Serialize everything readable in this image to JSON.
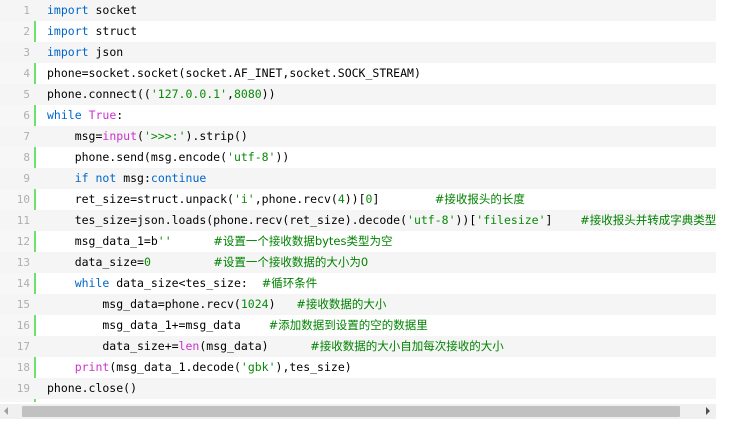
{
  "lines": [
    {
      "n": "1",
      "tokens": [
        {
          "t": "import",
          "c": "k"
        },
        {
          "t": " socket"
        }
      ]
    },
    {
      "n": "2",
      "tokens": [
        {
          "t": "import",
          "c": "k"
        },
        {
          "t": " struct"
        }
      ]
    },
    {
      "n": "3",
      "tokens": [
        {
          "t": "import",
          "c": "k"
        },
        {
          "t": " json"
        }
      ]
    },
    {
      "n": "4",
      "tokens": [
        {
          "t": "phone=socket.socket(socket.AF_INET,socket.SOCK_STREAM)"
        }
      ]
    },
    {
      "n": "5",
      "tokens": [
        {
          "t": "phone.connect(("
        },
        {
          "t": "'127.0.0.1'",
          "c": "s"
        },
        {
          "t": ","
        },
        {
          "t": "8080",
          "c": "n"
        },
        {
          "t": "))"
        }
      ]
    },
    {
      "n": "6",
      "tokens": [
        {
          "t": "while",
          "c": "k"
        },
        {
          "t": " "
        },
        {
          "t": "True",
          "c": "f"
        },
        {
          "t": ":"
        }
      ]
    },
    {
      "n": "7",
      "tokens": [
        {
          "t": "    msg="
        },
        {
          "t": "input",
          "c": "f"
        },
        {
          "t": "("
        },
        {
          "t": "'>>>:'",
          "c": "s"
        },
        {
          "t": ").strip()"
        }
      ]
    },
    {
      "n": "8",
      "tokens": [
        {
          "t": "    phone.send(msg.encode("
        },
        {
          "t": "'utf-8'",
          "c": "s"
        },
        {
          "t": "))"
        }
      ]
    },
    {
      "n": "9",
      "tokens": [
        {
          "t": "    "
        },
        {
          "t": "if",
          "c": "k"
        },
        {
          "t": " "
        },
        {
          "t": "not",
          "c": "k"
        },
        {
          "t": " msg:"
        },
        {
          "t": "continue",
          "c": "k"
        }
      ]
    },
    {
      "n": "10",
      "tokens": [
        {
          "t": "    ret_size=struct.unpack("
        },
        {
          "t": "'i'",
          "c": "s"
        },
        {
          "t": ",phone.recv("
        },
        {
          "t": "4",
          "c": "n"
        },
        {
          "t": "))["
        },
        {
          "t": "0",
          "c": "n"
        },
        {
          "t": "]        "
        },
        {
          "t": "#接收报头的长度",
          "c": "c"
        }
      ]
    },
    {
      "n": "11",
      "tokens": [
        {
          "t": "    tes_size=json.loads(phone.recv(ret_size).decode("
        },
        {
          "t": "'utf-8'",
          "c": "s"
        },
        {
          "t": "))["
        },
        {
          "t": "'filesize'",
          "c": "s"
        },
        {
          "t": "]    "
        },
        {
          "t": "#接收报头并转成字典类型",
          "c": "c"
        }
      ]
    },
    {
      "n": "12",
      "tokens": [
        {
          "t": "    msg_data_1=b"
        },
        {
          "t": "''",
          "c": "s"
        },
        {
          "t": "      "
        },
        {
          "t": "#设置一个接收数据bytes类型为空",
          "c": "c"
        }
      ]
    },
    {
      "n": "13",
      "tokens": [
        {
          "t": "    data_size="
        },
        {
          "t": "0",
          "c": "n"
        },
        {
          "t": "         "
        },
        {
          "t": "#设置一个接收数据的大小为0",
          "c": "c"
        }
      ]
    },
    {
      "n": "14",
      "tokens": [
        {
          "t": "    "
        },
        {
          "t": "while",
          "c": "k"
        },
        {
          "t": " data_size<tes_size:  "
        },
        {
          "t": "#循环条件",
          "c": "c"
        }
      ]
    },
    {
      "n": "15",
      "tokens": [
        {
          "t": "        msg_data=phone.recv("
        },
        {
          "t": "1024",
          "c": "n"
        },
        {
          "t": ")   "
        },
        {
          "t": "#接收数据的大小",
          "c": "c"
        }
      ]
    },
    {
      "n": "16",
      "tokens": [
        {
          "t": "        msg_data_1+=msg_data    "
        },
        {
          "t": "#添加数据到设置的空的数据里",
          "c": "c"
        }
      ]
    },
    {
      "n": "17",
      "tokens": [
        {
          "t": "        data_size+="
        },
        {
          "t": "len",
          "c": "f"
        },
        {
          "t": "(msg_data)      "
        },
        {
          "t": "#接收数据的大小自加每次接收的大小",
          "c": "c"
        }
      ]
    },
    {
      "n": "18",
      "tokens": [
        {
          "t": "    "
        },
        {
          "t": "print",
          "c": "f"
        },
        {
          "t": "(msg_data_1.decode("
        },
        {
          "t": "'gbk'",
          "c": "s"
        },
        {
          "t": "),tes_size)"
        }
      ]
    },
    {
      "n": "19",
      "tokens": [
        {
          "t": "phone.close()"
        }
      ]
    }
  ],
  "icons": {
    "scroll_left": "triangle-left-icon",
    "scroll_right": "triangle-right-icon"
  },
  "colors": {
    "keyword": "#0066cc",
    "string": "#0a8a0a",
    "comment": "#008200",
    "builtin": "#cc33cc",
    "gutter_border": "#6ce26c"
  }
}
